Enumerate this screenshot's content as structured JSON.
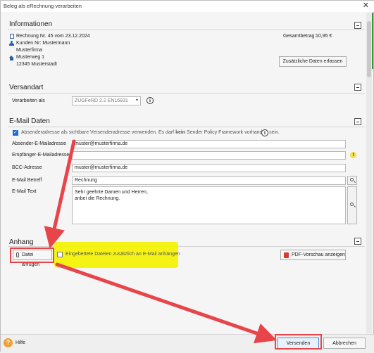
{
  "window": {
    "title": "Beleg als eRechnung verarbeiten",
    "close_glyph": "✕"
  },
  "info": {
    "heading": "Informationen",
    "invoice": "Rechnung Nr. 45 vom 23.12.2024",
    "customer": "Kunden Nr: Mustermann",
    "company": "Musterfirma",
    "street": "Musterweg 1",
    "city": "12345 Musterstadt",
    "total_label": "Gesamtbetrag:",
    "total_value": "10,95 €",
    "extra_button": "Zusätzliche Daten erfassen"
  },
  "shipping": {
    "heading": "Versandart",
    "process_label": "Verarbeiten als",
    "process_value": "ZUGFeRD 2.2 EN16931",
    "info_glyph": "i"
  },
  "email": {
    "heading": "E-Mail Daten",
    "sender_checkbox_text_pre": "Absenderadresse als sichtbare Versenderadresse verwenden. Es darf",
    "sender_checkbox_text_bold": "kein",
    "sender_checkbox_text_post": "Sender Policy Framework vorhanden sein.",
    "sender_label": "Absender-E-Mailadresse",
    "sender_value": "muster@musterfirma.de",
    "recipient_label": "Empfänger-E-Mailadresse",
    "recipient_value": "",
    "bcc_label": "BCC-Adresse",
    "bcc_value": "muster@musterfirma.de",
    "subject_label": "E-Mail Betreff",
    "subject_value": "Rechnung",
    "body_label": "E-Mail Text",
    "body_line1": "Sehr geehrte Damen und Herren,",
    "body_line2": "anbei die Rechnung."
  },
  "attachment": {
    "heading": "Anhang",
    "attach_button": "Datei anfügen",
    "embed_checkbox": "Eingebettete Dateien zusätzlich an E-Mail anhängen",
    "preview_button": "PDF-Vorschau anzeigen"
  },
  "footer": {
    "help_glyph": "?",
    "help_label": "Hilfe",
    "send_button": "Versenden",
    "cancel_button": "Abbrechen"
  },
  "colors": {
    "annotation_red": "#e8454a",
    "highlight_yellow": "#f4f200",
    "checkbox_blue": "#1e6fd1",
    "accent_green": "#2e9e3a"
  },
  "icons": [
    "document-icon",
    "person-icon",
    "house-icon",
    "info-icon",
    "dropdown-arrow-icon",
    "search-icon",
    "warning-icon",
    "paperclip-icon",
    "pdf-icon",
    "help-icon",
    "close-icon",
    "collapse-icon"
  ]
}
